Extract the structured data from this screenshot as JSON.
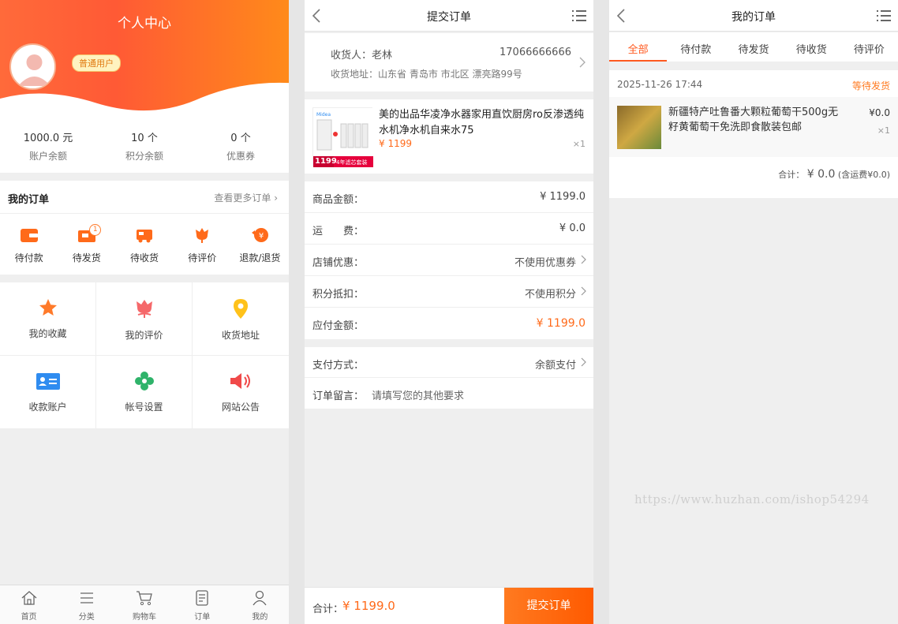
{
  "profile": {
    "title": "个人中心",
    "user_badge": "普通用户",
    "stats": [
      {
        "value": "1000.0 元",
        "label": "账户余额"
      },
      {
        "value": "10 个",
        "label": "积分余额"
      },
      {
        "value": "0 个",
        "label": "优惠券"
      }
    ],
    "orders_title": "我的订单",
    "orders_more": "查看更多订单",
    "order_items": [
      {
        "label": "待付款",
        "icon": "wallet-icon"
      },
      {
        "label": "待发货",
        "icon": "shipping-icon",
        "badge": "1"
      },
      {
        "label": "待收货",
        "icon": "truck-icon"
      },
      {
        "label": "待评价",
        "icon": "flower-icon"
      },
      {
        "label": "退款/退货",
        "icon": "refund-icon"
      }
    ],
    "grid": [
      {
        "label": "我的收藏",
        "icon": "star-icon"
      },
      {
        "label": "我的评价",
        "icon": "tulip-icon"
      },
      {
        "label": "收货地址",
        "icon": "location-icon"
      },
      {
        "label": "收款账户",
        "icon": "id-card-icon"
      },
      {
        "label": "帐号设置",
        "icon": "gear-icon"
      },
      {
        "label": "网站公告",
        "icon": "speaker-icon"
      }
    ],
    "tabbar": [
      {
        "label": "首页",
        "icon": "home-icon"
      },
      {
        "label": "分类",
        "icon": "list-icon"
      },
      {
        "label": "购物车",
        "icon": "cart-icon"
      },
      {
        "label": "订单",
        "icon": "order-icon"
      },
      {
        "label": "我的",
        "icon": "user-icon"
      }
    ]
  },
  "checkout": {
    "title": "提交订单",
    "receiver": "收货人：老林",
    "phone": "17066666666",
    "address": "收货地址：山东省 青岛市 市北区 漂亮路99号",
    "product_name": "美的出品华凌净水器家用直饮厨房ro反渗透纯水机净水机自来水75",
    "product_price": "¥ 1199",
    "product_qty": "×1",
    "product_img_price": "1199",
    "product_img_tag": "4年滤芯套装",
    "rows": [
      {
        "key": "商品金额：",
        "value": "¥ 1199.0"
      },
      {
        "key": "运　　费：",
        "value": "¥ 0.0"
      },
      {
        "key": "店铺优惠：",
        "value": "不使用优惠券"
      },
      {
        "key": "积分抵扣：",
        "value": "不使用积分"
      },
      {
        "key": "应付金额：",
        "value": "¥ 1199.0"
      }
    ],
    "pay_method_key": "支付方式：",
    "pay_method_value": "余额支付",
    "note_key": "订单留言：",
    "note_placeholder": "请填写您的其他要求",
    "total_label": "合计：",
    "total_value": "¥ 1199.0",
    "submit_label": "提交订单"
  },
  "my_orders": {
    "title": "我的订单",
    "tabs": [
      "全部",
      "待付款",
      "待发货",
      "待收货",
      "待评价"
    ],
    "active_tab": "全部",
    "order_date": "2025-11-26 17:44",
    "order_status": "等待发货",
    "item_name": "新疆特产吐鲁番大颗粒葡萄干500g无籽黄葡萄干免洗即食散装包邮",
    "item_price": "¥0.0",
    "item_qty": "×1",
    "sum_label": "合计：",
    "sum_value": "¥ 0.0",
    "sum_note": "(含运费¥0.0)",
    "watermark": "https://www.huzhan.com/ishop54294"
  },
  "colors": {
    "accent": "#ff5a20",
    "price": "#ff6a1a",
    "header_start": "#ff6a3a",
    "header_end": "#ff8a1a"
  }
}
